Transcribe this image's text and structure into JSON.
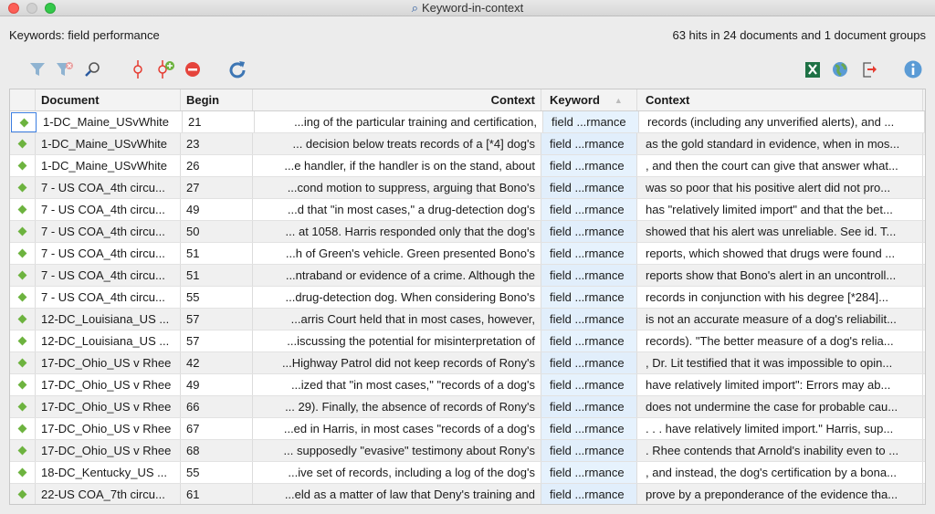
{
  "window": {
    "title": "Keyword-in-context"
  },
  "header": {
    "keywords": "Keywords: field performance",
    "hits": "63 hits in 24 documents and 1 document groups"
  },
  "toolbar": {
    "left": [
      "filter-icon",
      "clear-filter-icon",
      "search-icon",
      "code-icon",
      "add-code-icon",
      "remove-icon",
      "refresh-icon"
    ],
    "right": [
      "excel-export-icon",
      "web-export-icon",
      "export-icon",
      "info-icon"
    ]
  },
  "colors": {
    "marker": "#6db33f",
    "keyword_bg": "#e6f2fd",
    "accent": "#3b7de0"
  },
  "table": {
    "columns": [
      "",
      "Document",
      "Begin",
      "Context",
      "Keyword",
      "Context"
    ],
    "rows": [
      {
        "doc": "1-DC_Maine_USvWhite",
        "begin": "21",
        "left": "...ing of the particular training and certification,",
        "kw": "field ...rmance",
        "right": "records (including any unverified alerts), and ..."
      },
      {
        "doc": "1-DC_Maine_USvWhite",
        "begin": "23",
        "left": "... decision below treats records of a  [*4] dog's",
        "kw": "field ...rmance",
        "right": "as the gold standard in evidence, when in mos..."
      },
      {
        "doc": "1-DC_Maine_USvWhite",
        "begin": "26",
        "left": "...e handler, if the handler is on the stand, about",
        "kw": "field ...rmance",
        "right": ", and then the court can give that answer what..."
      },
      {
        "doc": "7 - US COA_4th circu...",
        "begin": "27",
        "left": "...cond motion to suppress, arguing that Bono's",
        "kw": "field ...rmance",
        "right": "was so poor that his positive alert did not pro..."
      },
      {
        "doc": "7 - US COA_4th circu...",
        "begin": "49",
        "left": "...d that \"in most cases,\" a drug-detection dog's",
        "kw": "field ...rmance",
        "right": "has \"relatively limited import\" and that the bet..."
      },
      {
        "doc": "7 - US COA_4th circu...",
        "begin": "50",
        "left": "... at 1058. Harris responded only that the dog's",
        "kw": "field ...rmance",
        "right": "showed that his alert was unreliable. See id. T..."
      },
      {
        "doc": "7 - US COA_4th circu...",
        "begin": "51",
        "left": "...h of Green's vehicle. Green presented Bono's",
        "kw": "field ...rmance",
        "right": "reports, which showed that drugs were found ..."
      },
      {
        "doc": "7 - US COA_4th circu...",
        "begin": "51",
        "left": "...ntraband or evidence of a crime. Although the",
        "kw": "field ...rmance",
        "right": "reports show that Bono's alert in an uncontroll..."
      },
      {
        "doc": "7 - US COA_4th circu...",
        "begin": "55",
        "left": "...drug-detection dog. When considering Bono's",
        "kw": "field ...rmance",
        "right": "records in conjunction with his degree  [*284]..."
      },
      {
        "doc": "12-DC_Louisiana_US ...",
        "begin": "57",
        "left": "...arris Court held that in most cases, however,",
        "kw": "field ...rmance",
        "right": "is not an accurate measure of a dog's reliabilit..."
      },
      {
        "doc": "12-DC_Louisiana_US ...",
        "begin": "57",
        "left": "...iscussing the potential for misinterpretation of",
        "kw": "field ...rmance",
        "right": "records). \"The better measure of a dog's relia..."
      },
      {
        "doc": "17-DC_Ohio_US v Rhee",
        "begin": "42",
        "left": "...Highway Patrol did not keep records of Rony's",
        "kw": "field ...rmance",
        "right": ", Dr. Lit testified that it was impossible to opin..."
      },
      {
        "doc": "17-DC_Ohio_US v Rhee",
        "begin": "49",
        "left": "...ized that \"in most cases,\" \"records of a dog's",
        "kw": "field ...rmance",
        "right": "have relatively limited import\":  Errors may ab..."
      },
      {
        "doc": "17-DC_Ohio_US v Rhee",
        "begin": "66",
        "left": "... 29). Finally, the absence of records of Rony's",
        "kw": "field ...rmance",
        "right": "does not undermine the case for probable cau..."
      },
      {
        "doc": "17-DC_Ohio_US v Rhee",
        "begin": "67",
        "left": "...ed in Harris, in most cases \"records of a dog's",
        "kw": "field ...rmance",
        "right": ". . . have relatively limited import.\" Harris, sup..."
      },
      {
        "doc": "17-DC_Ohio_US v Rhee",
        "begin": "68",
        "left": "... supposedly \"evasive\" testimony about Rony's",
        "kw": "field ...rmance",
        "right": ". Rhee contends that Arnold's inability even to ..."
      },
      {
        "doc": "18-DC_Kentucky_US ...",
        "begin": "55",
        "left": "...ive set of records, including a log of the dog's",
        "kw": "field ...rmance",
        "right": ", and instead, the dog's certification by a bona..."
      },
      {
        "doc": "22-US COA_7th circu...",
        "begin": "61",
        "left": "...eld as a matter of law that Deny's training and",
        "kw": "field ...rmance",
        "right": "prove by a preponderance of the evidence tha..."
      }
    ]
  }
}
